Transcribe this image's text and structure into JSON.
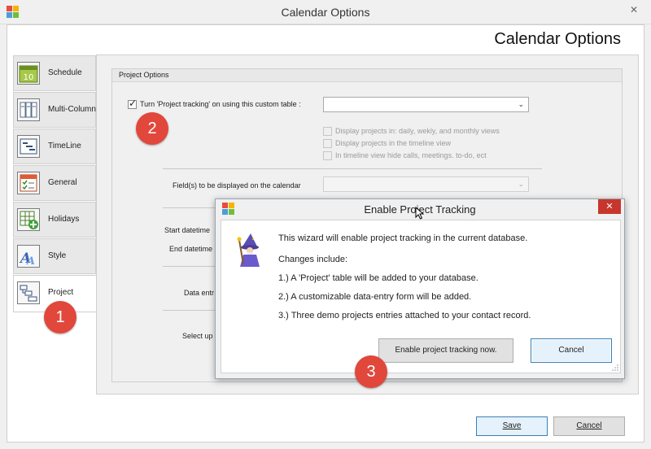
{
  "window": {
    "title": "Calendar Options",
    "close_glyph": "✕"
  },
  "header": {
    "title": "Calendar Options"
  },
  "side_tabs": [
    {
      "label": "Schedule",
      "icon": "calendar-day-icon"
    },
    {
      "label": "Multi-Column",
      "icon": "columns-icon"
    },
    {
      "label": "TimeLine",
      "icon": "timeline-icon"
    },
    {
      "label": "General",
      "icon": "checklist-icon"
    },
    {
      "label": "Holidays",
      "icon": "holidays-icon"
    },
    {
      "label": "Style",
      "icon": "style-icon"
    },
    {
      "label": "Project",
      "icon": "project-icon",
      "active": true
    }
  ],
  "schedule_icon_text": "10",
  "project_options": {
    "group_title": "Project Options",
    "enable_checkbox": {
      "label": "Turn 'Project tracking' on using this custom table :",
      "checked": true,
      "check_glyph": "✓"
    },
    "table_combo": {
      "value": "",
      "arrow": "⌄"
    },
    "sub_options": [
      "Display projects in: daily, wekly, and monthly views",
      "Display projects in the timeline view",
      "In timeline view hide calls, meetings. to-do, ect"
    ],
    "fields_label": "Field(s) to be displayed on the calendar",
    "fields_combo": {
      "value": "",
      "arrow": "⌄"
    },
    "start_label": "Start datetime",
    "end_label": "End datetime",
    "data_entry_label": "Data entr",
    "select_up_label": "Select up"
  },
  "popup": {
    "title": "Enable Project Tracking",
    "close_glyph": "✕",
    "lines": [
      "This wizard will enable project tracking in the current database.",
      "Changes include:",
      "1.) A 'Project' table will be added to your database.",
      "2.) A customizable data-entry form will be added.",
      "3.) Three demo projects entries attached to your contact record."
    ],
    "enable_button": "Enable project tracking now.",
    "cancel_button": "Cancel"
  },
  "badges": [
    "1",
    "2",
    "3"
  ],
  "footer": {
    "save": "Save",
    "cancel": "Cancel"
  },
  "colors": {
    "badge": "#e1473b",
    "popup_close": "#c7362c",
    "focus_border": "#3c7fb1"
  }
}
